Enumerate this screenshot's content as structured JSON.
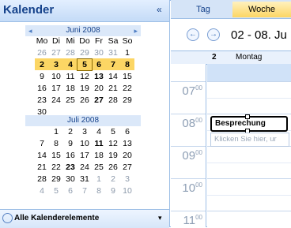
{
  "sidebar": {
    "title": "Kalender",
    "collapse_glyph": "«",
    "bottom_label": "Alle Kalenderelemente",
    "dropdown_glyph": "▾"
  },
  "june": {
    "header": "Juni 2008",
    "prev_glyph": "◂",
    "next_glyph": "▸",
    "daynames": [
      "Mo",
      "Di",
      "Mi",
      "Do",
      "Fr",
      "Sa",
      "So"
    ],
    "weeks": [
      [
        "26",
        "27",
        "28",
        "29",
        "30",
        "31",
        "1"
      ],
      [
        "2",
        "3",
        "4",
        "5",
        "6",
        "7",
        "8"
      ],
      [
        "9",
        "10",
        "11",
        "12",
        "13",
        "14",
        "15"
      ],
      [
        "16",
        "17",
        "18",
        "19",
        "20",
        "21",
        "22"
      ],
      [
        "23",
        "24",
        "25",
        "26",
        "27",
        "28",
        "29"
      ],
      [
        "30"
      ]
    ]
  },
  "july": {
    "header": "Juli 2008",
    "weeks": [
      [
        "",
        "1",
        "2",
        "3",
        "4",
        "5",
        "6"
      ],
      [
        "7",
        "8",
        "9",
        "10",
        "11",
        "12",
        "13"
      ],
      [
        "14",
        "15",
        "16",
        "17",
        "18",
        "19",
        "20"
      ],
      [
        "21",
        "22",
        "23",
        "24",
        "25",
        "26",
        "27"
      ],
      [
        "28",
        "29",
        "30",
        "31",
        "1",
        "2",
        "3"
      ],
      [
        "4",
        "5",
        "6",
        "7",
        "8",
        "9",
        "10"
      ]
    ]
  },
  "tabs": {
    "day": "Tag",
    "week": "Woche"
  },
  "nav": {
    "prev": "←",
    "next": "→",
    "range": "02 - 08. Ju"
  },
  "dayheader": {
    "num": "2",
    "name": "Montag"
  },
  "hours": [
    "07",
    "08",
    "09",
    "10",
    "11"
  ],
  "hour_minutes": "00",
  "appointment": "Besprechung",
  "new_appointment_hint": "Klicken Sie hier, ur",
  "colors": {
    "accent": "#15428b",
    "selection": "#fcd664",
    "header": "#dbe8f9"
  }
}
